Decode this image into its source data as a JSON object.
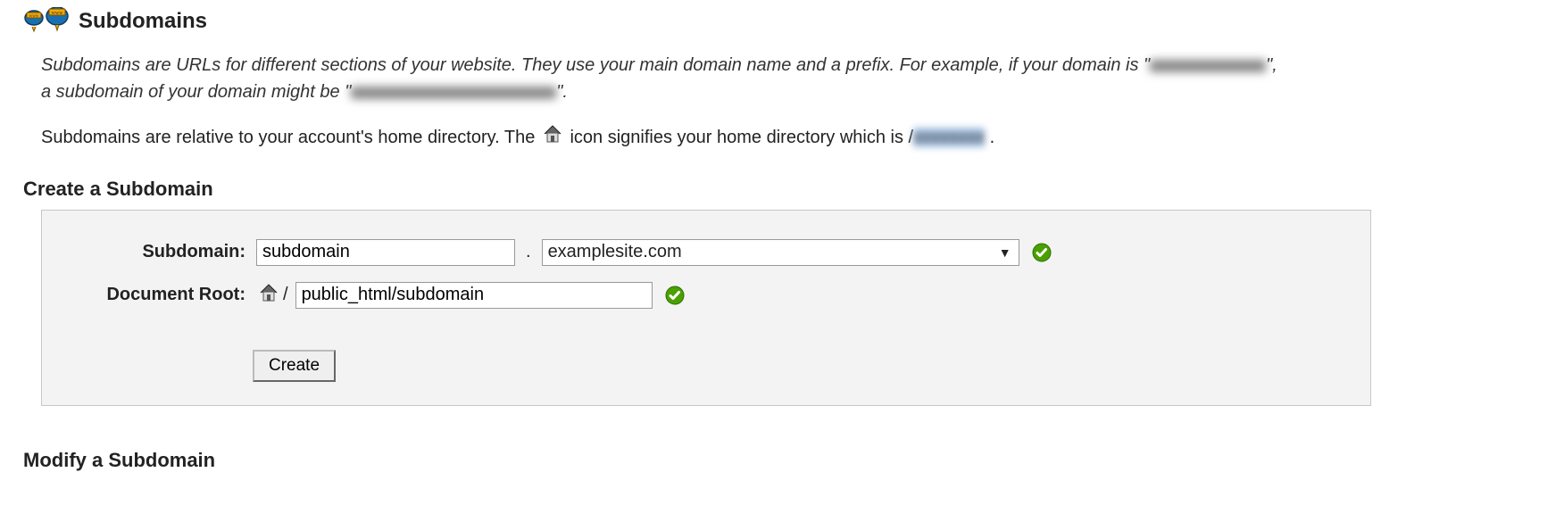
{
  "page_title": "Subdomains",
  "intro": {
    "part1": "Subdomains are URLs for different sections of your website. They use your main domain name and a prefix. For example, if your domain is \"",
    "part2": "\", a subdomain of your domain might be \"",
    "part3": "\"."
  },
  "home_line": {
    "before": "Subdomains are relative to your account's home directory. The ",
    "after": " icon signifies your home directory which is /",
    "end": " ."
  },
  "create_heading": "Create a Subdomain",
  "labels": {
    "subdomain": "Subdomain:",
    "docroot": "Document Root:"
  },
  "form": {
    "subdomain_value": "subdomain",
    "domain_selected": "examplesite.com",
    "docroot_prefix": "/",
    "docroot_value": "public_html/subdomain",
    "create_button": "Create"
  },
  "modify_heading": "Modify a Subdomain"
}
